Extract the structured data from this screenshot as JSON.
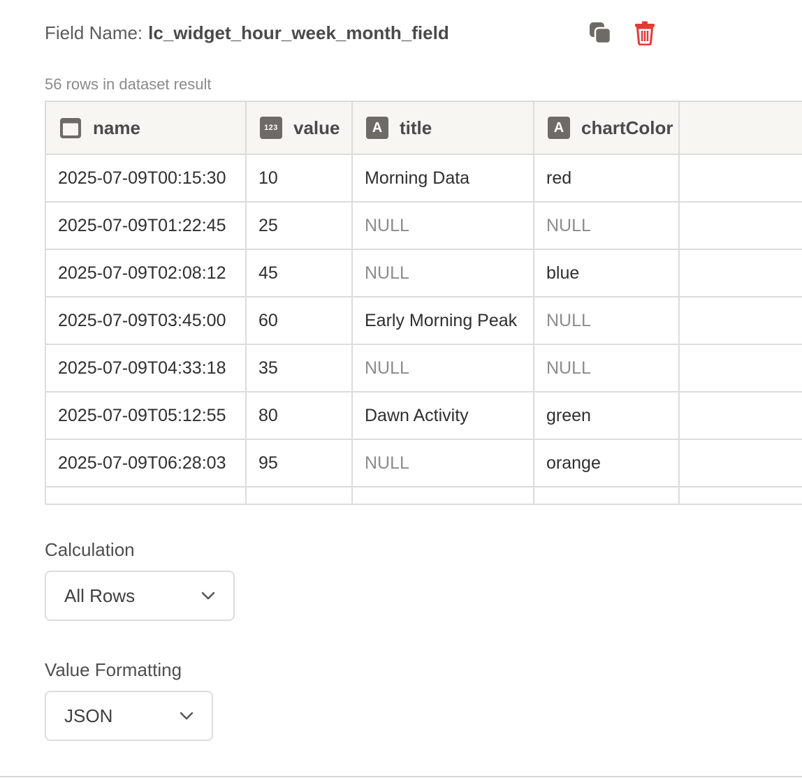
{
  "field": {
    "label": "Field Name:",
    "value": "lc_widget_hour_week_month_field"
  },
  "row_count": "56 rows in dataset result",
  "table": {
    "columns": [
      {
        "name": "name",
        "type_icon": "calendar-icon"
      },
      {
        "name": "value",
        "type_icon": "number-type-icon",
        "icon_text": "123"
      },
      {
        "name": "title",
        "type_icon": "text-type-icon",
        "icon_text": "A"
      },
      {
        "name": "chartColor",
        "type_icon": "text-type-icon",
        "icon_text": "A"
      }
    ],
    "rows": [
      [
        "2025-07-09T00:15:30",
        "10",
        "Morning Data",
        "red"
      ],
      [
        "2025-07-09T01:22:45",
        "25",
        "NULL",
        "NULL"
      ],
      [
        "2025-07-09T02:08:12",
        "45",
        "NULL",
        "blue"
      ],
      [
        "2025-07-09T03:45:00",
        "60",
        "Early Morning Peak",
        "NULL"
      ],
      [
        "2025-07-09T04:33:18",
        "35",
        "NULL",
        "NULL"
      ],
      [
        "2025-07-09T05:12:55",
        "80",
        "Dawn Activity",
        "green"
      ],
      [
        "2025-07-09T06:28:03",
        "95",
        "NULL",
        "orange"
      ]
    ]
  },
  "calculation": {
    "label": "Calculation",
    "selected": "All Rows"
  },
  "formatting": {
    "label": "Value Formatting",
    "selected": "JSON"
  },
  "colors": {
    "icon_gray": "#6e6a66",
    "trash_red": "#e53935",
    "header_bg": "#f8f6f2",
    "null_text": "#8c8c8c"
  }
}
